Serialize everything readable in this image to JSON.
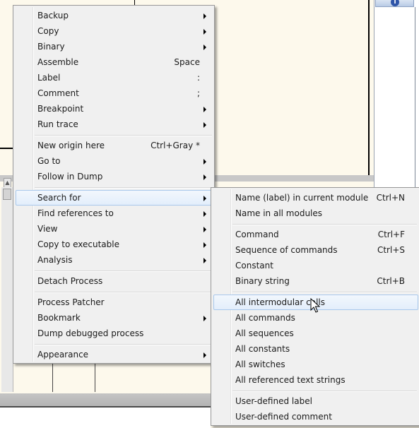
{
  "context_menu": {
    "items": [
      {
        "label": "Backup",
        "shortcut": "",
        "submenu": true
      },
      {
        "label": "Copy",
        "shortcut": "",
        "submenu": true
      },
      {
        "label": "Binary",
        "shortcut": "",
        "submenu": true
      },
      {
        "label": "Assemble",
        "shortcut": "Space",
        "submenu": false
      },
      {
        "label": "Label",
        "shortcut": ":",
        "submenu": false
      },
      {
        "label": "Comment",
        "shortcut": ";",
        "submenu": false
      },
      {
        "label": "Breakpoint",
        "shortcut": "",
        "submenu": true
      },
      {
        "label": "Run trace",
        "shortcut": "",
        "submenu": true
      },
      {
        "label": "New origin here",
        "shortcut": "Ctrl+Gray *",
        "submenu": false
      },
      {
        "label": "Go to",
        "shortcut": "",
        "submenu": true
      },
      {
        "label": "Follow in Dump",
        "shortcut": "",
        "submenu": true
      },
      {
        "label": "Search for",
        "shortcut": "",
        "submenu": true,
        "highlighted": true
      },
      {
        "label": "Find references to",
        "shortcut": "",
        "submenu": true
      },
      {
        "label": "View",
        "shortcut": "",
        "submenu": true
      },
      {
        "label": "Copy to executable",
        "shortcut": "",
        "submenu": true
      },
      {
        "label": "Analysis",
        "shortcut": "",
        "submenu": true
      },
      {
        "label": "Detach Process",
        "shortcut": "",
        "submenu": false
      },
      {
        "label": "Process Patcher",
        "shortcut": "",
        "submenu": false
      },
      {
        "label": "Bookmark",
        "shortcut": "",
        "submenu": true
      },
      {
        "label": "Dump debugged process",
        "shortcut": "",
        "submenu": false
      },
      {
        "label": "Appearance",
        "shortcut": "",
        "submenu": true
      }
    ]
  },
  "search_submenu": {
    "items": [
      {
        "label": "Name (label) in current module",
        "shortcut": "Ctrl+N"
      },
      {
        "label": "Name in all modules",
        "shortcut": ""
      },
      {
        "label": "Command",
        "shortcut": "Ctrl+F"
      },
      {
        "label": "Sequence of commands",
        "shortcut": "Ctrl+S"
      },
      {
        "label": "Constant",
        "shortcut": ""
      },
      {
        "label": "Binary string",
        "shortcut": "Ctrl+B"
      },
      {
        "label": "All intermodular calls",
        "shortcut": "",
        "highlighted": true
      },
      {
        "label": "All commands",
        "shortcut": ""
      },
      {
        "label": "All sequences",
        "shortcut": ""
      },
      {
        "label": "All constants",
        "shortcut": ""
      },
      {
        "label": "All switches",
        "shortcut": ""
      },
      {
        "label": "All referenced text strings",
        "shortcut": ""
      },
      {
        "label": "User-defined label",
        "shortcut": ""
      },
      {
        "label": "User-defined comment",
        "shortcut": ""
      }
    ]
  },
  "colors": {
    "menu_bg": "#f0f0f0",
    "highlight_border": "#a8c8ec",
    "pane_bg": "#fdf9ec"
  },
  "icons": {
    "info": "info-icon",
    "cursor": "mouse-pointer-icon",
    "submenu": "submenu-arrow-icon"
  }
}
